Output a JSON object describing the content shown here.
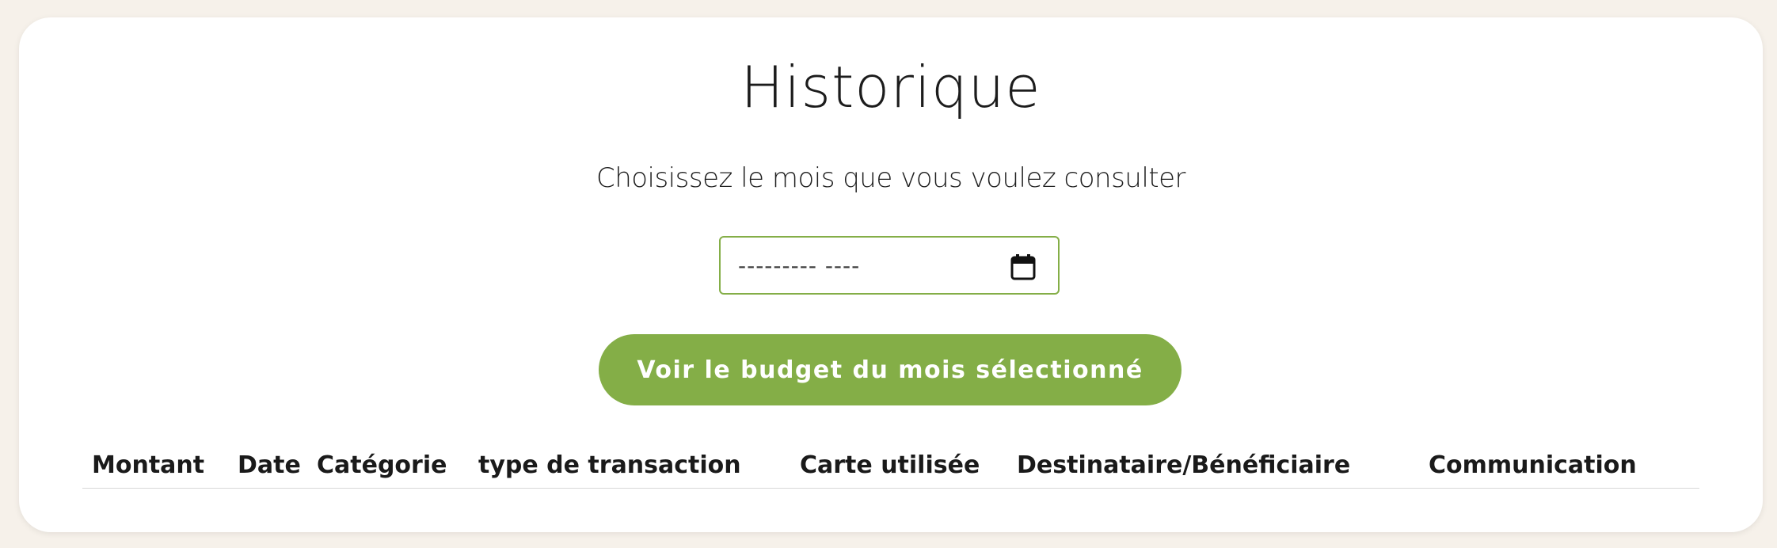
{
  "page": {
    "title": "Historique",
    "subtitle": "Choisissez le mois que vous voulez consulter"
  },
  "month_picker": {
    "placeholder": "--------- ----",
    "icon": "calendar-icon"
  },
  "submit_button": {
    "label": "Voir le budget du mois sélectionné"
  },
  "table": {
    "columns": [
      "Montant",
      "Date",
      "Catégorie",
      "type de transaction",
      "Carte utilisée",
      "Destinataire/Bénéficiaire",
      "Communication"
    ],
    "rows": []
  },
  "colors": {
    "accent": "#84ae47",
    "background": "#f6f1ea",
    "card": "#ffffff"
  }
}
